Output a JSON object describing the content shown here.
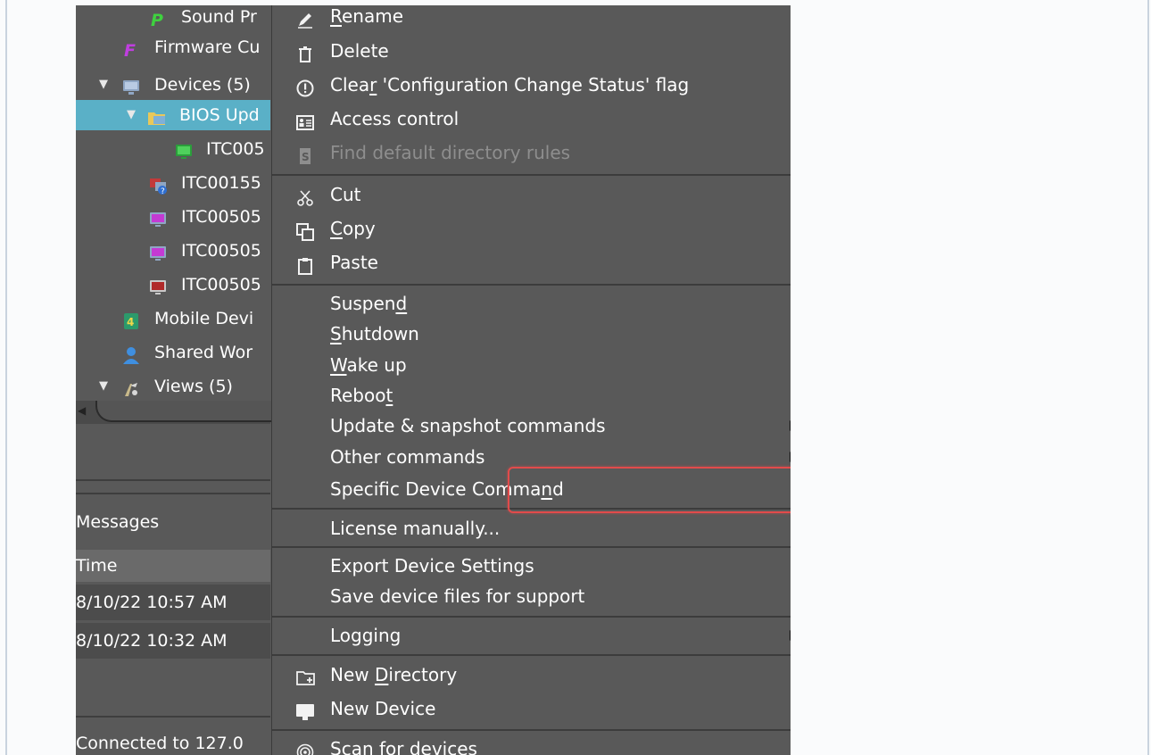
{
  "tree": {
    "items": [
      {
        "label": "Sound Pr",
        "icon": "sound-profile-icon"
      },
      {
        "label": "Firmware Cu",
        "icon": "firmware-icon"
      },
      {
        "label": "Devices (5)",
        "icon": "devices-monitor-icon",
        "expanded": true
      },
      {
        "label": "BIOS Upd",
        "icon": "folder-icon",
        "expanded": true,
        "selected": true
      },
      {
        "label": "ITC005",
        "icon": "device-green-icon"
      },
      {
        "label": "ITC00155",
        "icon": "device-unknown-icon"
      },
      {
        "label": "ITC00505",
        "icon": "device-magenta-icon"
      },
      {
        "label": "ITC00505",
        "icon": "device-magenta-icon"
      },
      {
        "label": "ITC00505",
        "icon": "device-red-icon"
      },
      {
        "label": "Mobile Devi",
        "icon": "mobile-device-icon"
      },
      {
        "label": "Shared Wor",
        "icon": "user-icon"
      },
      {
        "label": "Views (5)",
        "icon": "views-icon",
        "expanded": true
      }
    ]
  },
  "messages": {
    "title": "Messages",
    "column_time": "Time",
    "rows": [
      "8/10/22 10:57 AM",
      "8/10/22 10:32 AM"
    ]
  },
  "status": {
    "text": "Connected to 127.0"
  },
  "menu": {
    "rename": {
      "pre": "",
      "u": "R",
      "post": "ename"
    },
    "delete": "Delete",
    "clear_flag": {
      "pre": "Clea",
      "u": "r",
      "post": " 'Configuration Change Status' flag"
    },
    "access_control": "Access control",
    "find_rules": "Find default directory rules",
    "cut": "Cut",
    "copy": {
      "pre": "",
      "u": "C",
      "post": "opy"
    },
    "paste": "Paste",
    "suspend": {
      "pre": "Suspen",
      "u": "d",
      "post": ""
    },
    "shutdown": {
      "pre": "",
      "u": "S",
      "post": "hutdown"
    },
    "wakeup": {
      "pre": "",
      "u": "W",
      "post": "ake up"
    },
    "reboot": {
      "pre": "Reboo",
      "u": "t",
      "post": ""
    },
    "update_snapshot": "Update & snapshot commands",
    "other_commands": "Other commands",
    "specific_command": {
      "pre": "Specific Device Comma",
      "u": "n",
      "post": "d"
    },
    "license": "License manually...",
    "export_settings": "Export Device Settings",
    "save_files": "Save device files for support",
    "logging": "Logging",
    "new_directory": {
      "pre": "New ",
      "u": "D",
      "post": "irectory"
    },
    "new_device": "New Device",
    "scan": "Scan for devices"
  },
  "colors": {
    "menu_bg": "#595959",
    "selection": "#5ab0c7",
    "highlight_box": "#e24b4b",
    "disabled_text": "#8e8e8e"
  }
}
